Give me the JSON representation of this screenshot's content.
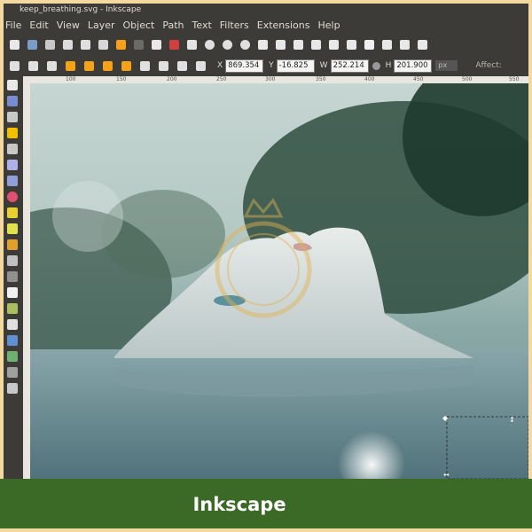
{
  "window": {
    "title": "keep_breathing.svg - Inkscape"
  },
  "menu": [
    "File",
    "Edit",
    "View",
    "Layer",
    "Object",
    "Path",
    "Text",
    "Filters",
    "Extensions",
    "Help"
  ],
  "controls": {
    "x_label": "X",
    "x_value": "869.354",
    "y_label": "Y",
    "y_value": "-16.825",
    "w_label": "W",
    "w_value": "252.214",
    "h_label": "H",
    "h_value": "201.900",
    "unit": "px",
    "affect_label": "Affect:"
  },
  "ruler": {
    "ticks": [
      "100",
      "150",
      "200",
      "250",
      "300",
      "350",
      "400",
      "450",
      "500",
      "550"
    ]
  },
  "colors": {
    "accent": "#f3a21a",
    "chrome": "#3c3b37",
    "caption_bar": "#3b6a26"
  },
  "caption": "Inkscape"
}
